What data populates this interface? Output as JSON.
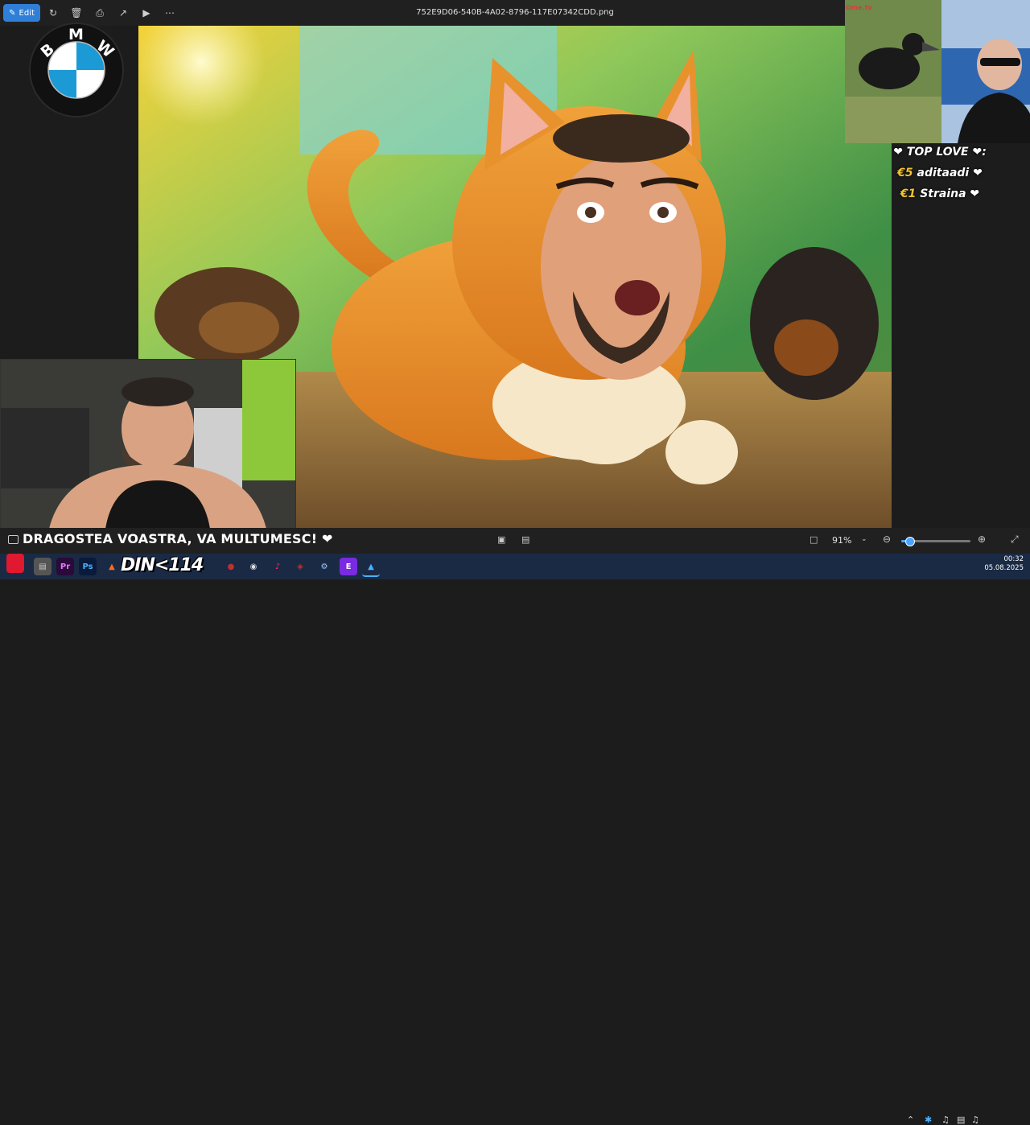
{
  "toolbar": {
    "edit_label": "Edit",
    "filename": "752E9D06-540B-4A02-8796-117E07342CDD.png"
  },
  "logo": {
    "letters": [
      "B",
      "M",
      "W"
    ]
  },
  "omegle": {
    "logo_text": "Ome.tv"
  },
  "top_love": {
    "title": "❤ TOP LOVE ❤:",
    "entries": [
      {
        "amount": "€5",
        "name": "aditaadi ❤"
      },
      {
        "amount": "€1",
        "name": "Straina ❤"
      }
    ]
  },
  "banner": {
    "text": "DRAGOSTEA VOASTRA, VA MULTUMESC! ❤"
  },
  "viewer": {
    "zoom": "91%",
    "zoom_fraction": 0.12
  },
  "overlay": {
    "din_text": "DIN<114"
  },
  "clock": {
    "time": "00:32",
    "date": "05.08.2025"
  },
  "colors": {
    "accent": "#2f7fd8",
    "taskbar": "#1a2a44",
    "bmw_blue": "#1c9ad6"
  }
}
